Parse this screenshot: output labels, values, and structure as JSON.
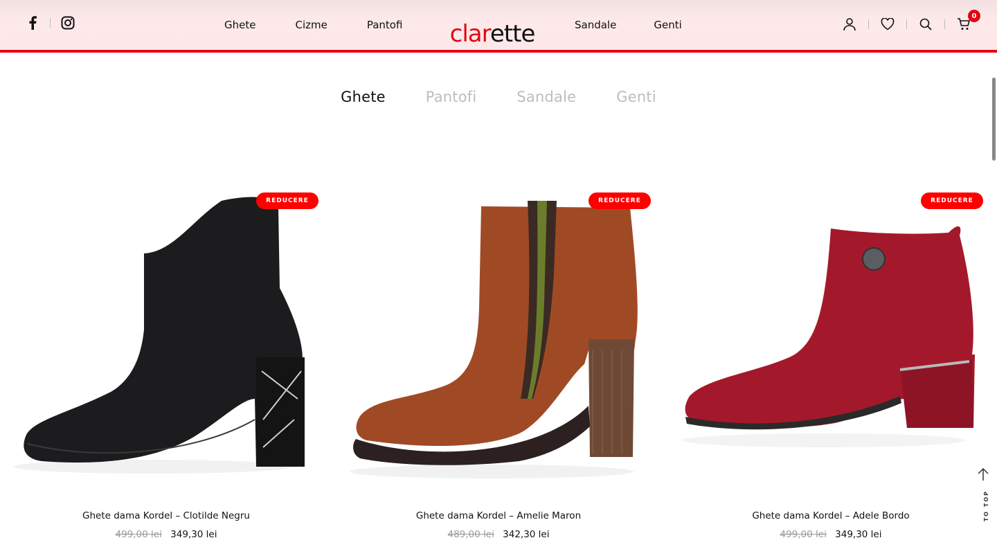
{
  "header": {
    "logo_main": "clar",
    "logo_accent": "ette",
    "nav_left": [
      "Ghete",
      "Cizme",
      "Pantofi"
    ],
    "nav_right": [
      "Sandale",
      "Genti"
    ],
    "cart_count": "0"
  },
  "tabs": [
    {
      "label": "Ghete",
      "active": true
    },
    {
      "label": "Pantofi",
      "active": false
    },
    {
      "label": "Sandale",
      "active": false
    },
    {
      "label": "Genti",
      "active": false
    }
  ],
  "products": [
    {
      "badge": "REDUCERE",
      "title": "Ghete dama Kordel – Clotilde Negru",
      "old_price": "499,00 lei",
      "new_price": "349,30 lei",
      "color": "#1c1c1e"
    },
    {
      "badge": "REDUCERE",
      "title": "Ghete dama Kordel – Amelie Maron",
      "old_price": "489,00 lei",
      "new_price": "342,30 lei",
      "color": "#a04a25"
    },
    {
      "badge": "REDUCERE",
      "title": "Ghete dama Kordel – Adele Bordo",
      "old_price": "499,00 lei",
      "new_price": "349,30 lei",
      "color": "#a3192b"
    }
  ],
  "to_top_label": "TO TOP",
  "colors": {
    "accent": "#e30613",
    "header_bg": "#fde8e9",
    "badge": "#ff0000"
  }
}
